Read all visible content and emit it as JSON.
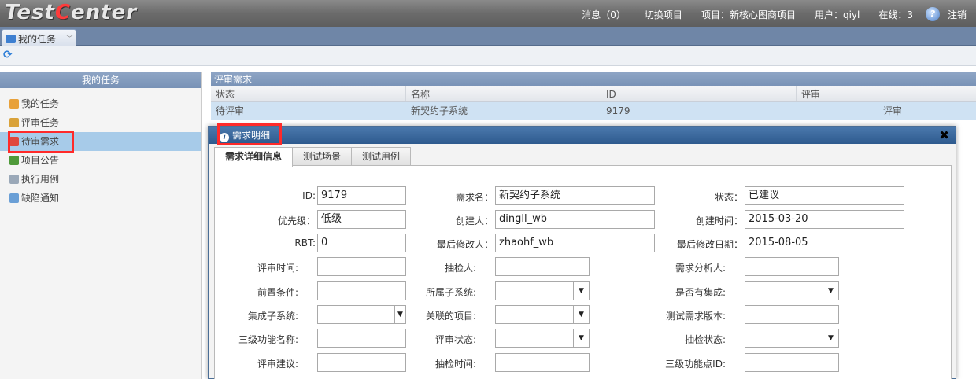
{
  "app": {
    "logo_prefix": "T",
    "logo_mid": "est",
    "logo_c": "C",
    "logo_suffix": "enter"
  },
  "topnav": {
    "messages": "消息（0）",
    "switch_project": "切换项目",
    "project": "项目：新核心图商项目",
    "user": "用户：qiyl",
    "online": "在线：3",
    "help_icon": "?",
    "logout": "注销"
  },
  "tabs": {
    "my_tasks": "我的任务"
  },
  "left_panel": {
    "title": "我的任务",
    "items": [
      {
        "label": "我的任务",
        "icon": "user-icon",
        "color": "#e8a13a"
      },
      {
        "label": "评审任务",
        "icon": "edit-icon",
        "color": "#d9a23a"
      },
      {
        "label": "待审需求",
        "icon": "heart-icon",
        "color": "#e0473c"
      },
      {
        "label": "项目公告",
        "icon": "notice-icon",
        "color": "#4f9a3a"
      },
      {
        "label": "执行用例",
        "icon": "run-icon",
        "color": "#9aa8b8"
      },
      {
        "label": "缺陷通知",
        "icon": "bug-icon",
        "color": "#6a9fd6"
      }
    ]
  },
  "review_grid": {
    "title": "评审需求",
    "columns": [
      "状态",
      "名称",
      "ID",
      "评审"
    ],
    "rows": [
      {
        "status": "待评审",
        "name": "新契约子系统",
        "id": "9179",
        "review": "评审"
      }
    ]
  },
  "dialog": {
    "title": "需求明细",
    "tabs": [
      "需求详细信息",
      "测试场景",
      "测试用例"
    ],
    "fields": {
      "id_label": "ID:",
      "id_value": "9179",
      "name_label": "需求名：",
      "name_value": "新契约子系统",
      "status_label": "状态：",
      "status_value": "已建议",
      "priority_label": "优先级：",
      "priority_value": "低级",
      "creator_label": "创建人：",
      "creator_value": "dingll_wb",
      "created_label": "创建时间：",
      "created_value": "2015-03-20",
      "rbt_label": "RBT:",
      "rbt_value": "0",
      "modifier_label": "最后修改人：",
      "modifier_value": "zhaohf_wb",
      "modified_label": "最后修改日期：",
      "modified_value": "2015-08-05",
      "review_time_label": "评审时间:",
      "inspector_label": "抽检人:",
      "analyst_label": "需求分析人:",
      "precondition_label": "前置条件:",
      "subsystem_label": "所属子系统:",
      "integrated_label": "是否有集成:",
      "integ_subsystem_label": "集成子系统:",
      "linked_project_label": "关联的项目:",
      "test_version_label": "测试需求版本:",
      "level3_name_label": "三级功能名称:",
      "review_state_label": "评审状态:",
      "inspect_state_label": "抽检状态:",
      "review_advice_label": "评审建议:",
      "inspect_time_label": "抽检时间:",
      "level3_id_label": "三级功能点ID:"
    }
  },
  "colors": {
    "highlight_box": "#ff2a2a",
    "dialog_title": "#2e5a8e",
    "selected_row": "#cfe2f3"
  }
}
